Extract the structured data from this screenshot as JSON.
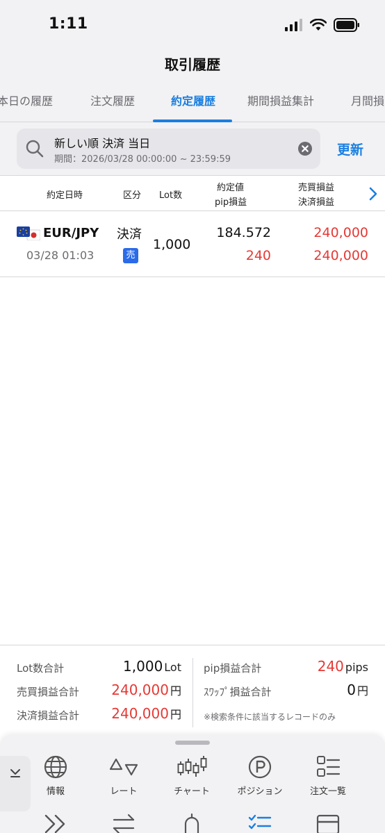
{
  "status_bar": {
    "time": "1:11"
  },
  "header": {
    "title": "取引履歴"
  },
  "tabs": [
    {
      "label": "本日の履歴"
    },
    {
      "label": "注文履歴"
    },
    {
      "label": "約定履歴"
    },
    {
      "label": "期間損益集計"
    },
    {
      "label": "月間損"
    }
  ],
  "search": {
    "line1": "新しい順 決済 当日",
    "line2": "期間：2026/03/28 00:00:00 ~ 23:59:59",
    "refresh_label": "更新"
  },
  "table": {
    "headers": {
      "date": "約定日時",
      "kubun": "区分",
      "lots": "Lot数",
      "rate_top": "約定値",
      "rate_bottom": "pip損益",
      "pl_top": "売買損益",
      "pl_bottom": "決済損益"
    },
    "rows": [
      {
        "pair": "EUR/JPY",
        "time": "03/28 01:03",
        "kubun": "決済",
        "side": "売",
        "lots": "1,000",
        "rate": "184.572",
        "pips": "240",
        "trade_pl": "240,000",
        "settle_pl": "240,000"
      }
    ]
  },
  "summary": {
    "lot_label": "Lot数合計",
    "lot_value": "1,000",
    "lot_unit": "Lot",
    "trade_pl_label": "売買損益合計",
    "trade_pl_value": "240,000",
    "settle_pl_label": "決済損益合計",
    "settle_pl_value": "240,000",
    "yen_unit": "円",
    "pip_label": "pip損益合計",
    "pip_value": "240",
    "pip_unit": "pips",
    "swap_label": "ｽﾜｯﾌﾟ損益合計",
    "swap_value": "0",
    "note": "※検索条件に該当するレコードのみ"
  },
  "bottom_nav": {
    "row1": [
      {
        "label": "情報",
        "icon": "globe-icon"
      },
      {
        "label": "レート",
        "icon": "rate-icon"
      },
      {
        "label": "チャート",
        "icon": "candlestick-icon"
      },
      {
        "label": "ポジション",
        "icon": "position-icon"
      },
      {
        "label": "注文一覧",
        "icon": "list-icon"
      }
    ],
    "row2_icons": [
      "fast-forward-icon",
      "swap-arrows-icon",
      "bell-icon",
      "checklist-icon",
      "card-icon"
    ]
  },
  "colors": {
    "accent": "#1a7fe0",
    "negative": "#e53935",
    "sell_badge": "#2b6be8"
  }
}
